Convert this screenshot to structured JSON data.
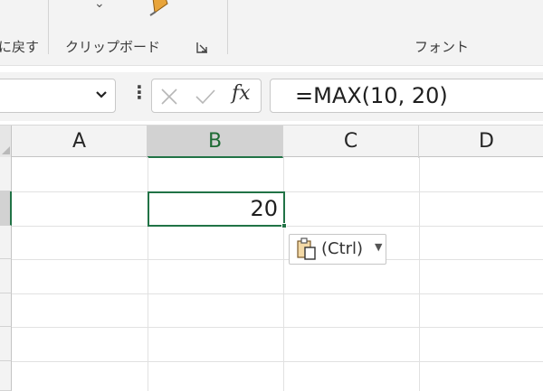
{
  "ribbon": {
    "undo_label": "に戻す",
    "clipboard_label": "クリップボード",
    "font_label": "フォント",
    "clipboard_expand_icon": "dialog-launcher-icon",
    "paste_dropdown_icon": "chevron-down-icon",
    "format_painter_icon": "format-painter-icon"
  },
  "formula_bar": {
    "namebox_value": "",
    "cancel_icon": "x-icon",
    "enter_icon": "check-icon",
    "fx_icon": "fx-icon",
    "formula": "=MAX(10, 20)"
  },
  "grid": {
    "columns": [
      "A",
      "B",
      "C",
      "D"
    ],
    "selected_column": "B",
    "active_cell_value": "20"
  },
  "paste_options": {
    "label": "(Ctrl)",
    "icon": "clipboard-icon"
  },
  "colors": {
    "accent": "#217346",
    "header_bg": "#f3f3f3",
    "selected_header": "#d2d2d2"
  }
}
